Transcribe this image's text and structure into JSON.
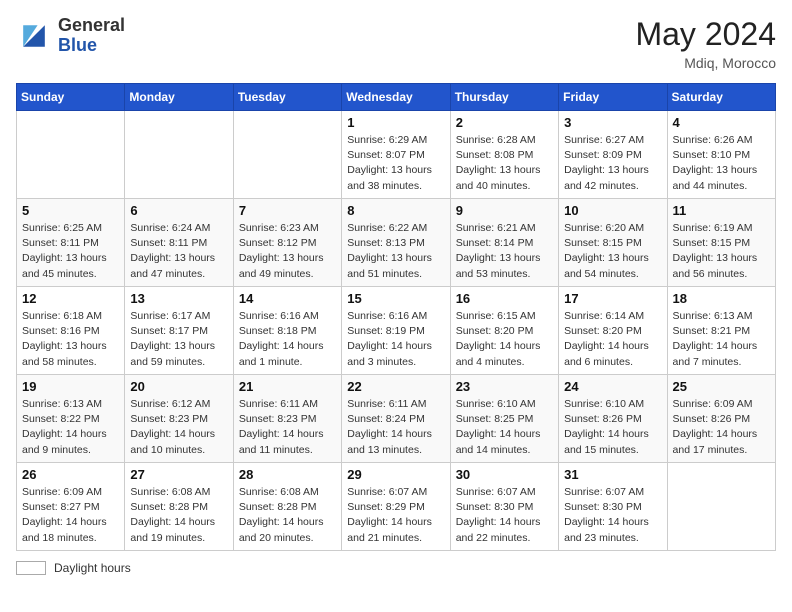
{
  "header": {
    "logo_general": "General",
    "logo_blue": "Blue",
    "month_year": "May 2024",
    "location": "Mdiq, Morocco"
  },
  "weekdays": [
    "Sunday",
    "Monday",
    "Tuesday",
    "Wednesday",
    "Thursday",
    "Friday",
    "Saturday"
  ],
  "footer": {
    "label": "Daylight hours"
  },
  "weeks": [
    [
      {
        "day": "",
        "sunrise": "",
        "sunset": "",
        "daylight": ""
      },
      {
        "day": "",
        "sunrise": "",
        "sunset": "",
        "daylight": ""
      },
      {
        "day": "",
        "sunrise": "",
        "sunset": "",
        "daylight": ""
      },
      {
        "day": "1",
        "sunrise": "Sunrise: 6:29 AM",
        "sunset": "Sunset: 8:07 PM",
        "daylight": "Daylight: 13 hours and 38 minutes."
      },
      {
        "day": "2",
        "sunrise": "Sunrise: 6:28 AM",
        "sunset": "Sunset: 8:08 PM",
        "daylight": "Daylight: 13 hours and 40 minutes."
      },
      {
        "day": "3",
        "sunrise": "Sunrise: 6:27 AM",
        "sunset": "Sunset: 8:09 PM",
        "daylight": "Daylight: 13 hours and 42 minutes."
      },
      {
        "day": "4",
        "sunrise": "Sunrise: 6:26 AM",
        "sunset": "Sunset: 8:10 PM",
        "daylight": "Daylight: 13 hours and 44 minutes."
      }
    ],
    [
      {
        "day": "5",
        "sunrise": "Sunrise: 6:25 AM",
        "sunset": "Sunset: 8:11 PM",
        "daylight": "Daylight: 13 hours and 45 minutes."
      },
      {
        "day": "6",
        "sunrise": "Sunrise: 6:24 AM",
        "sunset": "Sunset: 8:11 PM",
        "daylight": "Daylight: 13 hours and 47 minutes."
      },
      {
        "day": "7",
        "sunrise": "Sunrise: 6:23 AM",
        "sunset": "Sunset: 8:12 PM",
        "daylight": "Daylight: 13 hours and 49 minutes."
      },
      {
        "day": "8",
        "sunrise": "Sunrise: 6:22 AM",
        "sunset": "Sunset: 8:13 PM",
        "daylight": "Daylight: 13 hours and 51 minutes."
      },
      {
        "day": "9",
        "sunrise": "Sunrise: 6:21 AM",
        "sunset": "Sunset: 8:14 PM",
        "daylight": "Daylight: 13 hours and 53 minutes."
      },
      {
        "day": "10",
        "sunrise": "Sunrise: 6:20 AM",
        "sunset": "Sunset: 8:15 PM",
        "daylight": "Daylight: 13 hours and 54 minutes."
      },
      {
        "day": "11",
        "sunrise": "Sunrise: 6:19 AM",
        "sunset": "Sunset: 8:15 PM",
        "daylight": "Daylight: 13 hours and 56 minutes."
      }
    ],
    [
      {
        "day": "12",
        "sunrise": "Sunrise: 6:18 AM",
        "sunset": "Sunset: 8:16 PM",
        "daylight": "Daylight: 13 hours and 58 minutes."
      },
      {
        "day": "13",
        "sunrise": "Sunrise: 6:17 AM",
        "sunset": "Sunset: 8:17 PM",
        "daylight": "Daylight: 13 hours and 59 minutes."
      },
      {
        "day": "14",
        "sunrise": "Sunrise: 6:16 AM",
        "sunset": "Sunset: 8:18 PM",
        "daylight": "Daylight: 14 hours and 1 minute."
      },
      {
        "day": "15",
        "sunrise": "Sunrise: 6:16 AM",
        "sunset": "Sunset: 8:19 PM",
        "daylight": "Daylight: 14 hours and 3 minutes."
      },
      {
        "day": "16",
        "sunrise": "Sunrise: 6:15 AM",
        "sunset": "Sunset: 8:20 PM",
        "daylight": "Daylight: 14 hours and 4 minutes."
      },
      {
        "day": "17",
        "sunrise": "Sunrise: 6:14 AM",
        "sunset": "Sunset: 8:20 PM",
        "daylight": "Daylight: 14 hours and 6 minutes."
      },
      {
        "day": "18",
        "sunrise": "Sunrise: 6:13 AM",
        "sunset": "Sunset: 8:21 PM",
        "daylight": "Daylight: 14 hours and 7 minutes."
      }
    ],
    [
      {
        "day": "19",
        "sunrise": "Sunrise: 6:13 AM",
        "sunset": "Sunset: 8:22 PM",
        "daylight": "Daylight: 14 hours and 9 minutes."
      },
      {
        "day": "20",
        "sunrise": "Sunrise: 6:12 AM",
        "sunset": "Sunset: 8:23 PM",
        "daylight": "Daylight: 14 hours and 10 minutes."
      },
      {
        "day": "21",
        "sunrise": "Sunrise: 6:11 AM",
        "sunset": "Sunset: 8:23 PM",
        "daylight": "Daylight: 14 hours and 11 minutes."
      },
      {
        "day": "22",
        "sunrise": "Sunrise: 6:11 AM",
        "sunset": "Sunset: 8:24 PM",
        "daylight": "Daylight: 14 hours and 13 minutes."
      },
      {
        "day": "23",
        "sunrise": "Sunrise: 6:10 AM",
        "sunset": "Sunset: 8:25 PM",
        "daylight": "Daylight: 14 hours and 14 minutes."
      },
      {
        "day": "24",
        "sunrise": "Sunrise: 6:10 AM",
        "sunset": "Sunset: 8:26 PM",
        "daylight": "Daylight: 14 hours and 15 minutes."
      },
      {
        "day": "25",
        "sunrise": "Sunrise: 6:09 AM",
        "sunset": "Sunset: 8:26 PM",
        "daylight": "Daylight: 14 hours and 17 minutes."
      }
    ],
    [
      {
        "day": "26",
        "sunrise": "Sunrise: 6:09 AM",
        "sunset": "Sunset: 8:27 PM",
        "daylight": "Daylight: 14 hours and 18 minutes."
      },
      {
        "day": "27",
        "sunrise": "Sunrise: 6:08 AM",
        "sunset": "Sunset: 8:28 PM",
        "daylight": "Daylight: 14 hours and 19 minutes."
      },
      {
        "day": "28",
        "sunrise": "Sunrise: 6:08 AM",
        "sunset": "Sunset: 8:28 PM",
        "daylight": "Daylight: 14 hours and 20 minutes."
      },
      {
        "day": "29",
        "sunrise": "Sunrise: 6:07 AM",
        "sunset": "Sunset: 8:29 PM",
        "daylight": "Daylight: 14 hours and 21 minutes."
      },
      {
        "day": "30",
        "sunrise": "Sunrise: 6:07 AM",
        "sunset": "Sunset: 8:30 PM",
        "daylight": "Daylight: 14 hours and 22 minutes."
      },
      {
        "day": "31",
        "sunrise": "Sunrise: 6:07 AM",
        "sunset": "Sunset: 8:30 PM",
        "daylight": "Daylight: 14 hours and 23 minutes."
      },
      {
        "day": "",
        "sunrise": "",
        "sunset": "",
        "daylight": ""
      }
    ]
  ]
}
